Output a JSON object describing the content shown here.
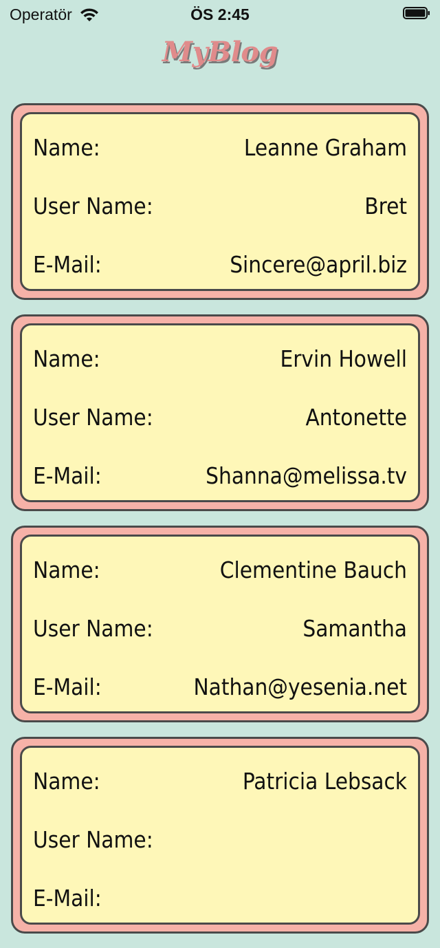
{
  "status_bar": {
    "carrier": "Operatör",
    "time": "ÖS 2:45",
    "wifi_icon": "wifi-icon",
    "battery_icon": "battery-icon"
  },
  "nav": {
    "title": "MyBlog"
  },
  "labels": {
    "name": "Name:",
    "username": "User Name:",
    "email": "E-Mail:"
  },
  "users": [
    {
      "name": "Leanne Graham",
      "username": "Bret",
      "email": "Sincere@april.biz"
    },
    {
      "name": "Ervin Howell",
      "username": "Antonette",
      "email": "Shanna@melissa.tv"
    },
    {
      "name": "Clementine Bauch",
      "username": "Samantha",
      "email": "Nathan@yesenia.net"
    },
    {
      "name": "Patricia Lebsack",
      "username": "",
      "email": ""
    }
  ],
  "colors": {
    "background": "#c9e6dd",
    "card_outer": "#f6b2a8",
    "card_inner": "#fef7b8",
    "title": "#e08b8b",
    "border": "#4a4a4a"
  }
}
